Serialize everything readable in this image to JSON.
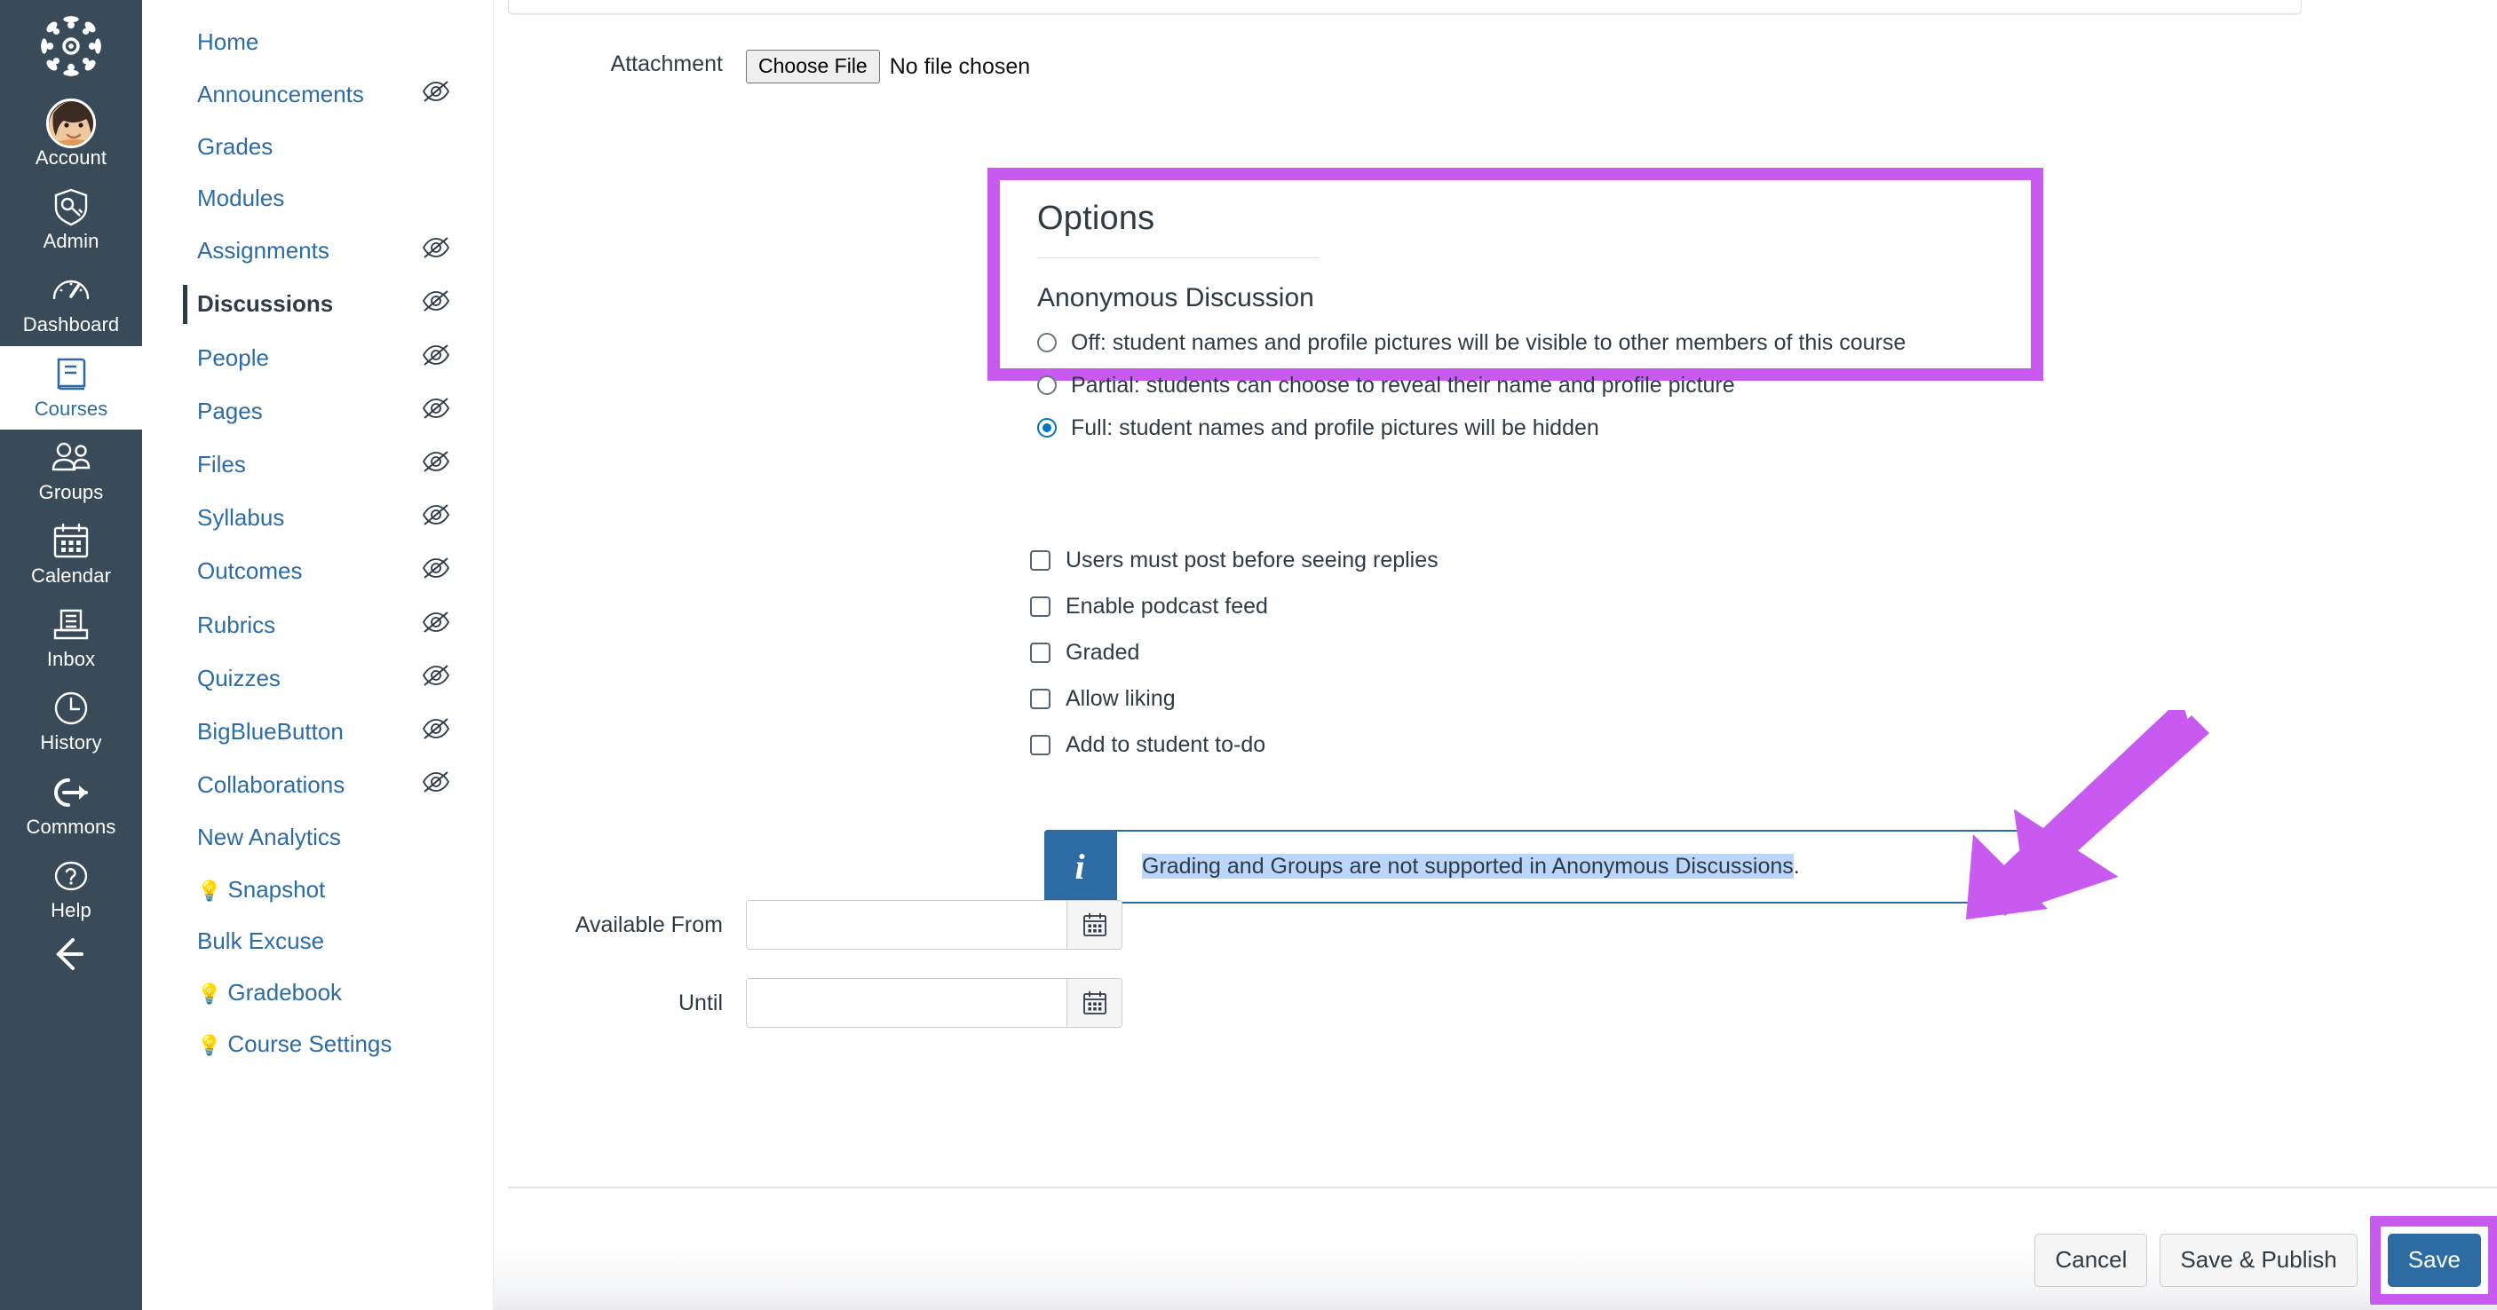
{
  "global_nav": {
    "logo_name": "canvas-logo",
    "items": [
      {
        "label": "Account",
        "icon": "avatar-icon",
        "active": false
      },
      {
        "label": "Admin",
        "icon": "shield-key-icon",
        "active": false
      },
      {
        "label": "Dashboard",
        "icon": "gauge-icon",
        "active": false
      },
      {
        "label": "Courses",
        "icon": "book-icon",
        "active": true
      },
      {
        "label": "Groups",
        "icon": "people-icon",
        "active": false
      },
      {
        "label": "Calendar",
        "icon": "calendar-icon",
        "active": false
      },
      {
        "label": "Inbox",
        "icon": "inbox-tray-icon",
        "active": false
      },
      {
        "label": "History",
        "icon": "clock-icon",
        "active": false
      },
      {
        "label": "Commons",
        "icon": "arrow-out-circle-icon",
        "active": false
      },
      {
        "label": "Help",
        "icon": "question-circle-icon",
        "active": false
      }
    ],
    "collapse_icon": "collapse-arrow-icon"
  },
  "course_nav": {
    "items": [
      {
        "label": "Home",
        "hidden_icon": false,
        "active": false,
        "emoji": ""
      },
      {
        "label": "Announcements",
        "hidden_icon": true,
        "active": false,
        "emoji": ""
      },
      {
        "label": "Grades",
        "hidden_icon": false,
        "active": false,
        "emoji": ""
      },
      {
        "label": "Modules",
        "hidden_icon": false,
        "active": false,
        "emoji": ""
      },
      {
        "label": "Assignments",
        "hidden_icon": true,
        "active": false,
        "emoji": ""
      },
      {
        "label": "Discussions",
        "hidden_icon": true,
        "active": true,
        "emoji": ""
      },
      {
        "label": "People",
        "hidden_icon": true,
        "active": false,
        "emoji": ""
      },
      {
        "label": "Pages",
        "hidden_icon": true,
        "active": false,
        "emoji": ""
      },
      {
        "label": "Files",
        "hidden_icon": true,
        "active": false,
        "emoji": ""
      },
      {
        "label": "Syllabus",
        "hidden_icon": true,
        "active": false,
        "emoji": ""
      },
      {
        "label": "Outcomes",
        "hidden_icon": true,
        "active": false,
        "emoji": ""
      },
      {
        "label": "Rubrics",
        "hidden_icon": true,
        "active": false,
        "emoji": ""
      },
      {
        "label": "Quizzes",
        "hidden_icon": true,
        "active": false,
        "emoji": ""
      },
      {
        "label": "BigBlueButton",
        "hidden_icon": true,
        "active": false,
        "emoji": ""
      },
      {
        "label": "Collaborations",
        "hidden_icon": true,
        "active": false,
        "emoji": ""
      },
      {
        "label": "New Analytics",
        "hidden_icon": false,
        "active": false,
        "emoji": ""
      },
      {
        "label": "Snapshot",
        "hidden_icon": false,
        "active": false,
        "emoji": "💡"
      },
      {
        "label": "Bulk Excuse",
        "hidden_icon": false,
        "active": false,
        "emoji": ""
      },
      {
        "label": "Gradebook",
        "hidden_icon": false,
        "active": false,
        "emoji": "💡"
      },
      {
        "label": "Course Settings",
        "hidden_icon": false,
        "active": false,
        "emoji": "💡"
      }
    ]
  },
  "form": {
    "attachment": {
      "label": "Attachment",
      "choose_file_label": "Choose File",
      "no_file_text": "No file chosen"
    },
    "options": {
      "title": "Options",
      "anonymous_section_title": "Anonymous Discussion",
      "radios": [
        {
          "label": "Off: student names and profile pictures will be visible to other members of this course",
          "checked": false
        },
        {
          "label": "Partial: students can choose to reveal their name and profile picture",
          "checked": false
        },
        {
          "label": "Full: student names and profile pictures will be hidden",
          "checked": true
        }
      ],
      "checkboxes": [
        {
          "label": "Users must post before seeing replies",
          "checked": false
        },
        {
          "label": "Enable podcast feed",
          "checked": false
        },
        {
          "label": "Graded",
          "checked": false
        },
        {
          "label": "Allow liking",
          "checked": false
        },
        {
          "label": "Add to student to-do",
          "checked": false
        }
      ]
    },
    "alert": {
      "icon": "info-icon",
      "highlighted_text": "Grading and Groups are not supported in Anonymous Discussions",
      "trailing_text": "."
    },
    "dates": [
      {
        "label": "Available From",
        "value": "",
        "calendar_icon": "calendar-icon"
      },
      {
        "label": "Until",
        "value": "",
        "calendar_icon": "calendar-icon"
      }
    ]
  },
  "footer": {
    "cancel_label": "Cancel",
    "save_publish_label": "Save & Publish",
    "save_label": "Save"
  },
  "annotation": {
    "highlight_color": "#C85AF0",
    "arrow_name": "purple-pointer-arrow"
  }
}
